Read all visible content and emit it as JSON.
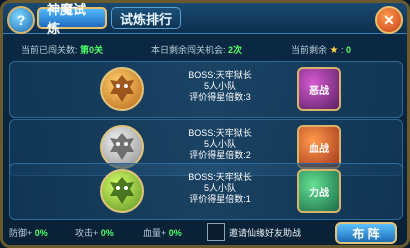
{
  "topbar": {
    "help_symbol": "?",
    "tabs": [
      {
        "label": "神魔试炼",
        "active": true
      },
      {
        "label": "试炼排行",
        "active": false
      }
    ],
    "close_symbol": "✕"
  },
  "status": {
    "current_stage_label": "当前已闯关数:",
    "current_stage_value": "第0关",
    "remaining_label": "本日剩余闯关机会:",
    "remaining_value": "2次",
    "current_stars_label": "当前剩余",
    "current_stars_value": "0"
  },
  "stages": [
    {
      "boss_label": "BOSS:天牢狱长",
      "team_label": "5人小队",
      "rating_label": "评价得星倍数:3",
      "badge_text": "恶战"
    },
    {
      "boss_label": "BOSS:天牢狱长",
      "team_label": "5人小队",
      "rating_label": "评价得星倍数:2",
      "badge_text": "血战"
    },
    {
      "boss_label": "BOSS:天牢狱长",
      "team_label": "5人小队",
      "rating_label": "评价得星倍数:1",
      "badge_text": "力战"
    }
  ],
  "bonuses": {
    "defense_label": "防御+",
    "defense_value": "0%",
    "attack_label": "攻击+",
    "attack_value": "0%",
    "hp_label": "血量+",
    "hp_value": "0%"
  },
  "invite_label": "邀请仙缘好友助战",
  "deploy_label": "布 阵",
  "colors": {
    "accent_blue": "#1c6cc0",
    "gold_border": "#e1c47b",
    "value_green": "#4dff6a"
  }
}
